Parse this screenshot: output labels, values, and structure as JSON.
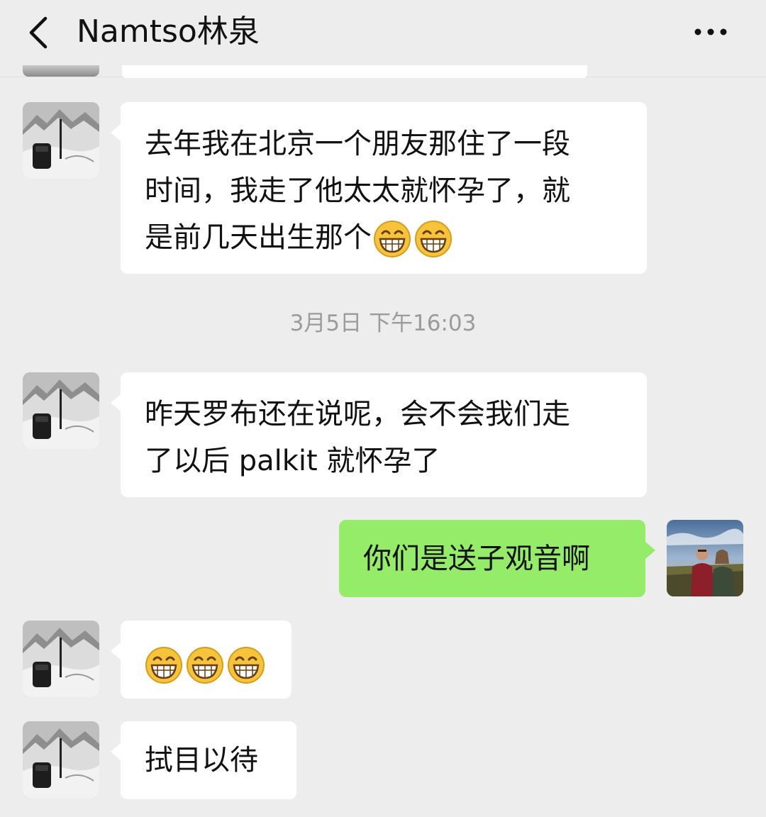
{
  "header": {
    "title": "Namtso林泉"
  },
  "timestamp": "3月5日 下午16:03",
  "messages": {
    "m1": {
      "line1": "去年我在北京一个朋友那住了一段",
      "line2": "时间，我走了他太太就怀孕了，就",
      "line3": "是前几天出生那个"
    },
    "m2": {
      "line1": "昨天罗布还在说呢，会不会我们走",
      "line2": "了以后 palkit 就怀孕了"
    },
    "m3": {
      "text": "你们是送子观音啊"
    },
    "m5": {
      "text": "拭目以待"
    }
  },
  "colors": {
    "background": "#ededed",
    "incoming_bubble": "#ffffff",
    "outgoing_bubble": "#95ec69",
    "timestamp_text": "#9b9b9b"
  },
  "icons": {
    "back": "chevron-left-icon",
    "more": "more-dots-icon",
    "emoji": "grin-emoji-icon"
  }
}
